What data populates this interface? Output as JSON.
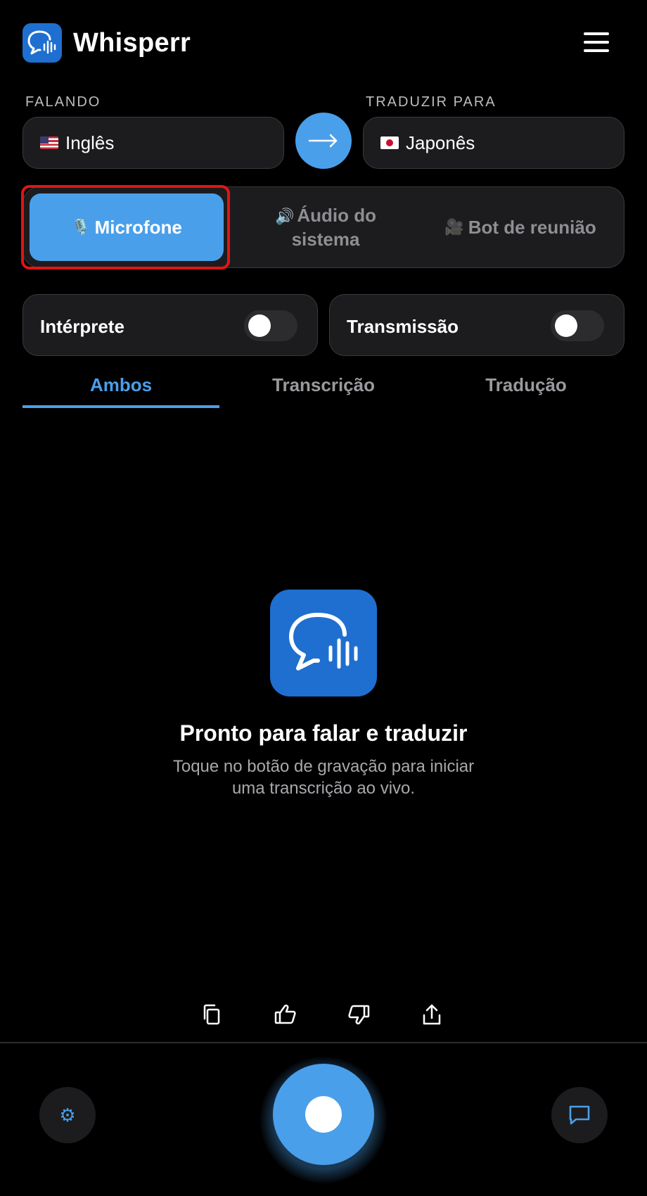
{
  "app": {
    "title": "Whisperr",
    "logo_icon": "speech-bubble-waveform-icon",
    "menu_icon": "hamburger-menu-icon"
  },
  "language": {
    "source_label": "FALANDO",
    "source_value": "Inglês",
    "source_flag": "us-flag-icon",
    "target_label": "TRADUZIR PARA",
    "target_value": "Japonês",
    "target_flag": "japan-flag-icon",
    "swap_icon": "arrow-right-icon"
  },
  "audio_source": {
    "options": [
      {
        "icon": "🎙️",
        "label": "Microfone",
        "active": true
      },
      {
        "icon": "🔊",
        "label": "Áudio do sistema",
        "active": false
      },
      {
        "icon": "🎥",
        "label": "Bot de reunião",
        "active": false
      }
    ]
  },
  "toggles": [
    {
      "label": "Intérprete",
      "on": false
    },
    {
      "label": "Transmissão",
      "on": false
    }
  ],
  "tabs": [
    {
      "label": "Ambos",
      "active": true
    },
    {
      "label": "Transcrição",
      "active": false
    },
    {
      "label": "Tradução",
      "active": false
    }
  ],
  "empty_state": {
    "icon": "speech-bubble-waveform-icon",
    "title": "Pronto para falar e traduzir",
    "subtitle": "Toque no botão de gravação para iniciar uma transcrição ao vivo."
  },
  "actions": [
    "copy-icon",
    "thumbs-up-icon",
    "thumbs-down-icon",
    "share-icon"
  ],
  "bottom_bar": {
    "settings_icon": "gear-icon",
    "record_icon": "record-icon",
    "chat_icon": "chat-icon"
  },
  "colors": {
    "accent": "#4A9FEA",
    "logo": "#1E6FD0",
    "highlight": "#E01515",
    "background": "#000000"
  }
}
